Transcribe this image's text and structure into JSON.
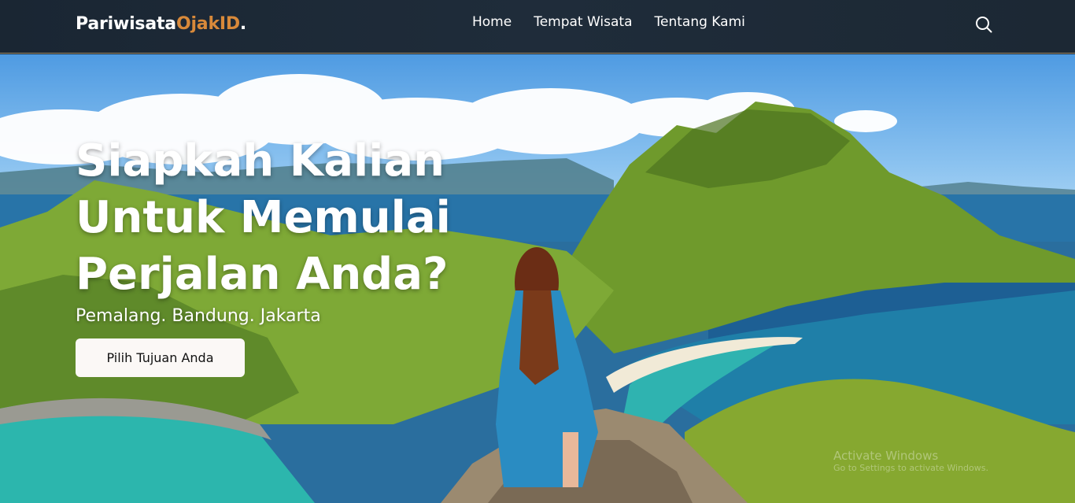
{
  "brand": {
    "name_main": "Pariwisata",
    "name_accent": "OjakID",
    "name_dot": "."
  },
  "nav": {
    "items": [
      {
        "label": "Home"
      },
      {
        "label": "Tempat Wisata"
      },
      {
        "label": "Tentang Kami"
      }
    ],
    "search_icon": "search-icon"
  },
  "hero": {
    "title_lines": [
      "Siapkah Kalian",
      "Untuk Memulai",
      "Perjalan Anda?"
    ],
    "subtitle": "Pemalang. Bandung. Jakarta",
    "cta_label": "Pilih Tujuan Anda"
  },
  "watermark": {
    "line1": "Activate Windows",
    "line2": "Go to Settings to activate Windows."
  },
  "colors": {
    "navbar_bg": "#1f2c3a",
    "brand_accent": "#d8893a",
    "cta_bg": "#fbf8f6"
  }
}
